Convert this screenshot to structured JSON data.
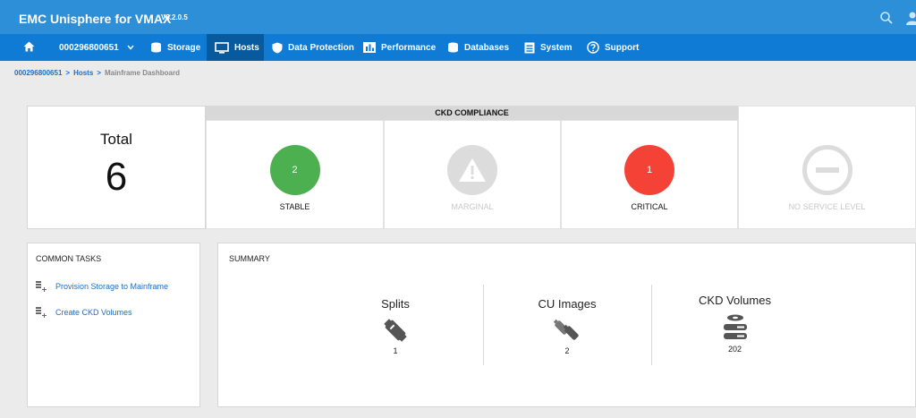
{
  "app": {
    "title": "EMC Unisphere for VMAX",
    "version": "V8.2.0.5"
  },
  "nav": {
    "symmetrix_id": "000296800651",
    "items": [
      {
        "label": "Storage",
        "icon": "database-icon"
      },
      {
        "label": "Hosts",
        "icon": "monitor-icon"
      },
      {
        "label": "Data Protection",
        "icon": "shield-icon"
      },
      {
        "label": "Performance",
        "icon": "bar-chart-icon"
      },
      {
        "label": "Databases",
        "icon": "database-icon"
      },
      {
        "label": "System",
        "icon": "document-icon"
      },
      {
        "label": "Support",
        "icon": "help-circle-icon"
      }
    ],
    "active": "Hosts"
  },
  "breadcrumb": {
    "items": [
      "000296800651",
      "Hosts"
    ],
    "current": "Mainframe Dashboard"
  },
  "total": {
    "label": "Total",
    "value": "6"
  },
  "compliance": {
    "header": "CKD COMPLIANCE",
    "items": [
      {
        "status": "STABLE",
        "count": "2",
        "color": "#4caf50"
      },
      {
        "status": "MARGINAL",
        "count": "",
        "color": "#dcdcdc"
      },
      {
        "status": "CRITICAL",
        "count": "1",
        "color": "#f44336"
      },
      {
        "status": "NO SERVICE LEVEL",
        "count": "",
        "color": "#dcdcdc"
      }
    ]
  },
  "common_tasks": {
    "title": "COMMON TASKS",
    "items": [
      "Provision Storage to Mainframe",
      "Create CKD Volumes"
    ]
  },
  "summary": {
    "title": "SUMMARY",
    "items": [
      {
        "label": "Splits",
        "value": "1",
        "icon": "split-connector-icon"
      },
      {
        "label": "CU Images",
        "value": "2",
        "icon": "cu-images-icon"
      },
      {
        "label": "CKD Volumes",
        "value": "202",
        "icon": "disk-stack-icon"
      }
    ]
  },
  "colors": {
    "title_bar": "#2c8fd8",
    "nav_bar": "#0f7bd4",
    "nav_active": "#075a9e",
    "link": "#1e6fc4"
  }
}
